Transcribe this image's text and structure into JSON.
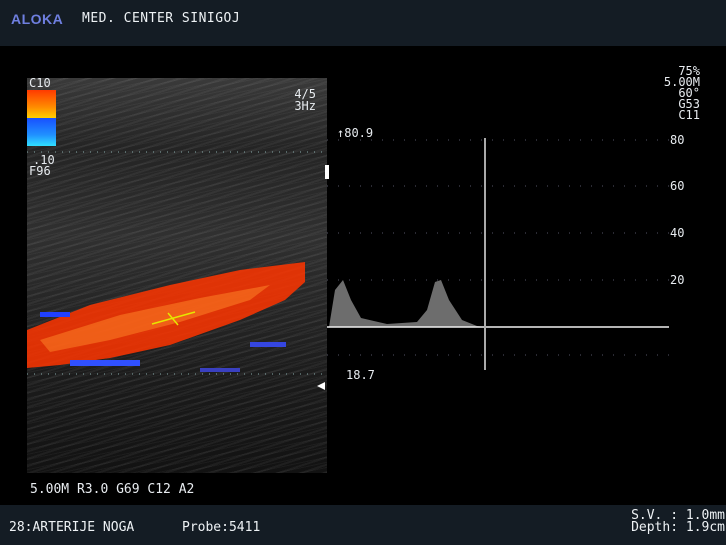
{
  "header": {
    "brand": "ALOKA",
    "center": "MED. CENTER SINIGOJ"
  },
  "color_map": {
    "top": "C10",
    "bottom": ".10",
    "filter": "F96"
  },
  "prf": {
    "ratio": "4/5",
    "rate": "3Hz"
  },
  "right_params": [
    "75%",
    "5.00M",
    "60°",
    "G53",
    "C11"
  ],
  "doppler": {
    "top_value": "↑80.9",
    "bottom_value": "18.7",
    "scale_labels": [
      "80",
      "60",
      "40",
      "20"
    ]
  },
  "bmode_params": "5.00M R3.0 G69 C12 A2",
  "footer": {
    "exam": "28:ARTERIJE NOGA",
    "probe": "Probe:5411",
    "sv": "S.V. : 1.0mm",
    "depth": "Depth: 1.9cm"
  },
  "colors": {
    "brand": "#6f7fe0",
    "bar": "#141c24",
    "flow": "#ff3000",
    "cursor": "#e6e600"
  }
}
